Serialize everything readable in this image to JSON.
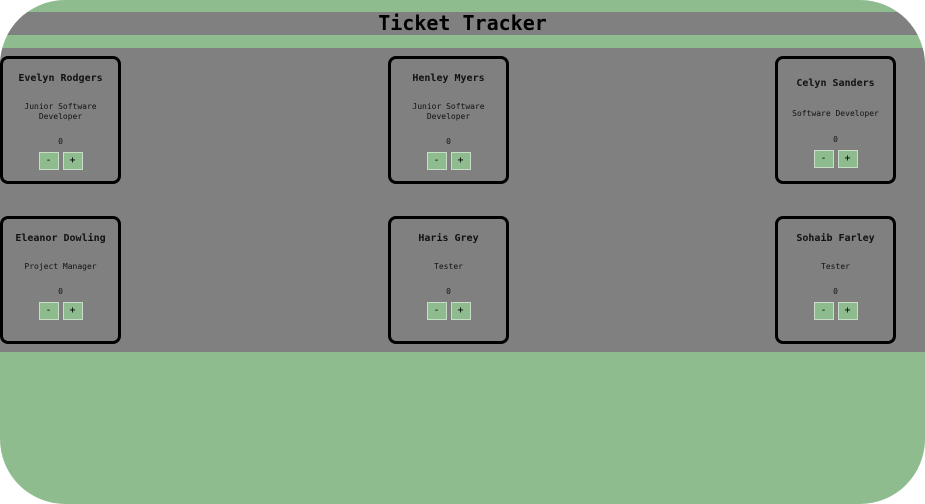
{
  "app": {
    "title": "Ticket Tracker"
  },
  "members": [
    {
      "name": "Evelyn Rodgers",
      "role": "Junior Software Developer",
      "count": "0",
      "minus": "-",
      "plus": "+"
    },
    {
      "name": "Henley Myers",
      "role": "Junior Software Developer",
      "count": "0",
      "minus": "-",
      "plus": "+"
    },
    {
      "name": "Celyn Sanders",
      "role": "Software Developer",
      "count": "0",
      "minus": "-",
      "plus": "+"
    },
    {
      "name": "Eleanor Dowling",
      "role": "Project Manager",
      "count": "0",
      "minus": "-",
      "plus": "+"
    },
    {
      "name": "Haris Grey",
      "role": "Tester",
      "count": "0",
      "minus": "-",
      "plus": "+"
    },
    {
      "name": "Sohaib Farley",
      "role": "Tester",
      "count": "0",
      "minus": "-",
      "plus": "+"
    }
  ],
  "colors": {
    "frame": "#8fbc8f",
    "board": "#808080",
    "button": "#8fbc8f",
    "border": "#000000"
  }
}
